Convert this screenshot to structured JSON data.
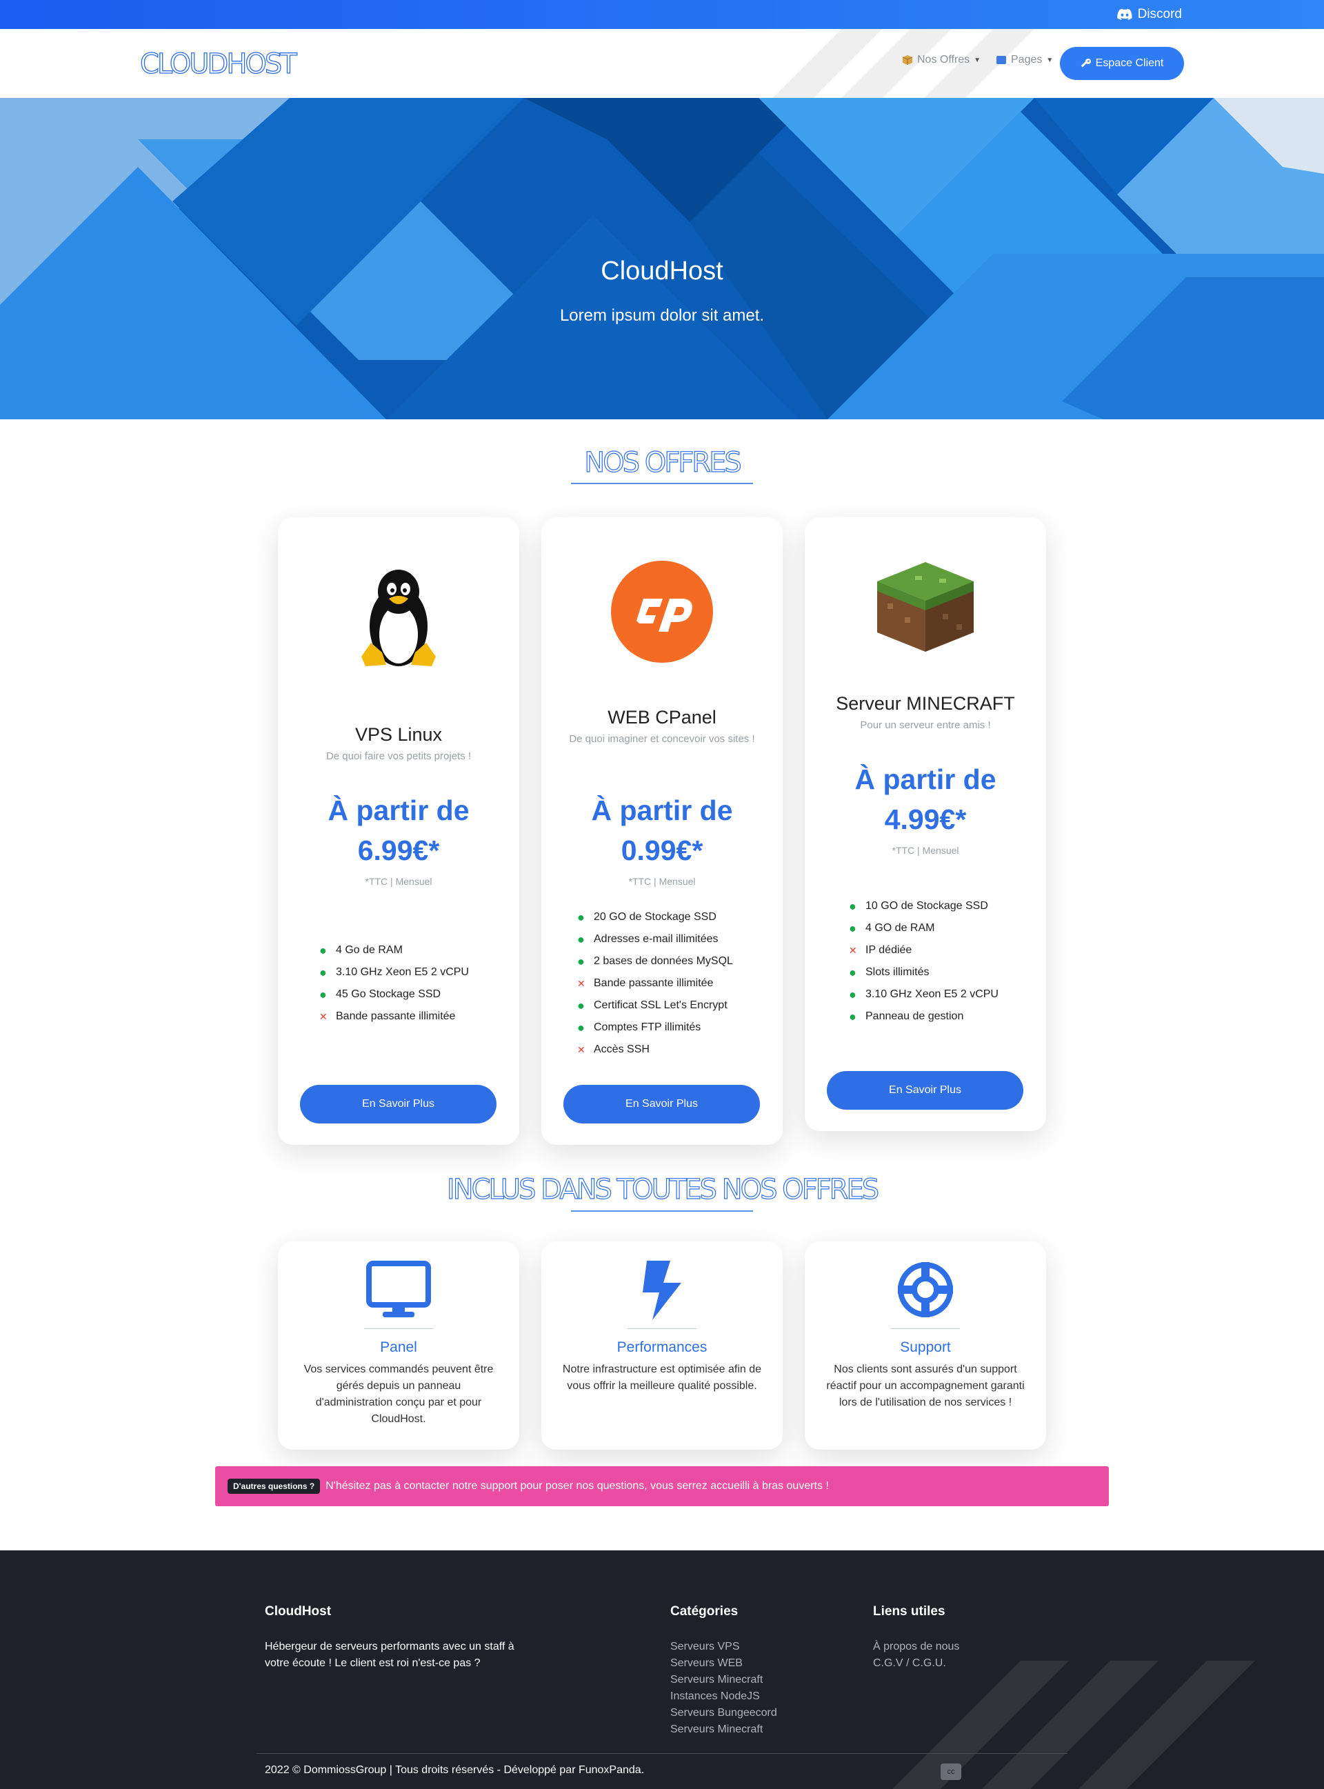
{
  "topbar": {
    "discord_label": "Discord"
  },
  "navbar": {
    "logo": "CLOUDHOST",
    "offres_label": "Nos Offres",
    "pages_label": "Pages",
    "client_label": "Espace Client"
  },
  "hero": {
    "title": "CloudHost",
    "subtitle": "Lorem ipsum dolor sit amet."
  },
  "offers": {
    "title": "NOS OFFRES",
    "cards": [
      {
        "name": "VPS Linux",
        "desc": "De quoi faire vos petits projets !",
        "price_line1": "À partir de",
        "price_line2": "6.99€*",
        "ttc": "*TTC | Mensuel",
        "features": [
          {
            "ok": true,
            "text": "4 Go de RAM"
          },
          {
            "ok": true,
            "text": "3.10 GHz Xeon E5 2 vCPU"
          },
          {
            "ok": true,
            "text": "45 Go Stockage SSD"
          },
          {
            "ok": false,
            "text": "Bande passante illimitée"
          }
        ],
        "button": "En Savoir Plus",
        "icon": "linux-penguin-icon"
      },
      {
        "name": "WEB CPanel",
        "desc": "De quoi imaginer et concevoir vos sites !",
        "price_line1": "À partir de",
        "price_line2": "0.99€*",
        "ttc": "*TTC | Mensuel",
        "features": [
          {
            "ok": true,
            "text": "20 GO de Stockage SSD"
          },
          {
            "ok": true,
            "text": "Adresses e-mail illimitées"
          },
          {
            "ok": true,
            "text": "2 bases de données MySQL"
          },
          {
            "ok": false,
            "text": "Bande passante illimitée"
          },
          {
            "ok": true,
            "text": "Certificat SSL Let's Encrypt"
          },
          {
            "ok": true,
            "text": "Comptes FTP illimités"
          },
          {
            "ok": false,
            "text": "Accès SSH"
          }
        ],
        "button": "En Savoir Plus",
        "icon": "cpanel-icon"
      },
      {
        "name": "Serveur MINECRAFT",
        "desc": "Pour un serveur entre amis !",
        "price_line1": "À partir de",
        "price_line2": "4.99€*",
        "ttc": "*TTC | Mensuel",
        "features": [
          {
            "ok": true,
            "text": "10 GO de Stockage SSD"
          },
          {
            "ok": true,
            "text": "4 GO de RAM"
          },
          {
            "ok": false,
            "text": "IP dédiée"
          },
          {
            "ok": true,
            "text": "Slots illimités"
          },
          {
            "ok": true,
            "text": "3.10 GHz Xeon E5 2 vCPU"
          },
          {
            "ok": true,
            "text": "Panneau de gestion"
          }
        ],
        "button": "En Savoir Plus",
        "icon": "minecraft-grass-block-icon"
      }
    ]
  },
  "included": {
    "title": "INCLUS DANS TOUTES NOS OFFRES",
    "items": [
      {
        "title": "Panel",
        "text": "Vos services commandés peuvent être gérés depuis un panneau d'administration conçu par et pour CloudHost.",
        "icon": "monitor-icon"
      },
      {
        "title": "Performances",
        "text": "Notre infrastructure est optimisée afin de vous offrir la meilleure qualité possible.",
        "icon": "lightning-bolt-icon"
      },
      {
        "title": "Support",
        "text": "Nos clients sont assurés d'un support réactif pour un accompagnement garanti lors de l'utilisation de nos services !",
        "icon": "lifebuoy-icon"
      }
    ]
  },
  "alert": {
    "badge": "D'autres questions ?",
    "text": "N'hésitez pas à contacter notre support pour poser nos questions, vous serrez accueilli à bras ouverts !"
  },
  "footer": {
    "brand_heading": "CloudHost",
    "brand_text": "Hébergeur de serveurs performants avec un staff à votre écoute ! Le client est roi n'est-ce pas ?",
    "categories_heading": "Catégories",
    "categories": [
      "Serveurs VPS",
      "Serveurs WEB",
      "Serveurs Minecraft",
      "Instances NodeJS",
      "Serveurs Bungeecord",
      "Serveurs Minecraft"
    ],
    "links_heading": "Liens utiles",
    "links": [
      "À propos de nous",
      "C.G.V / C.G.U."
    ],
    "copyright": "2022 © DommiossGroup | Tous droits réservés - Développé par FunoxPanda.",
    "badge": "cc"
  },
  "colors": {
    "accent": "#2f6fe6",
    "alert": "#e94ca0",
    "footer_bg": "#1f2128",
    "ok": "#18a84a",
    "no": "#e53935"
  }
}
